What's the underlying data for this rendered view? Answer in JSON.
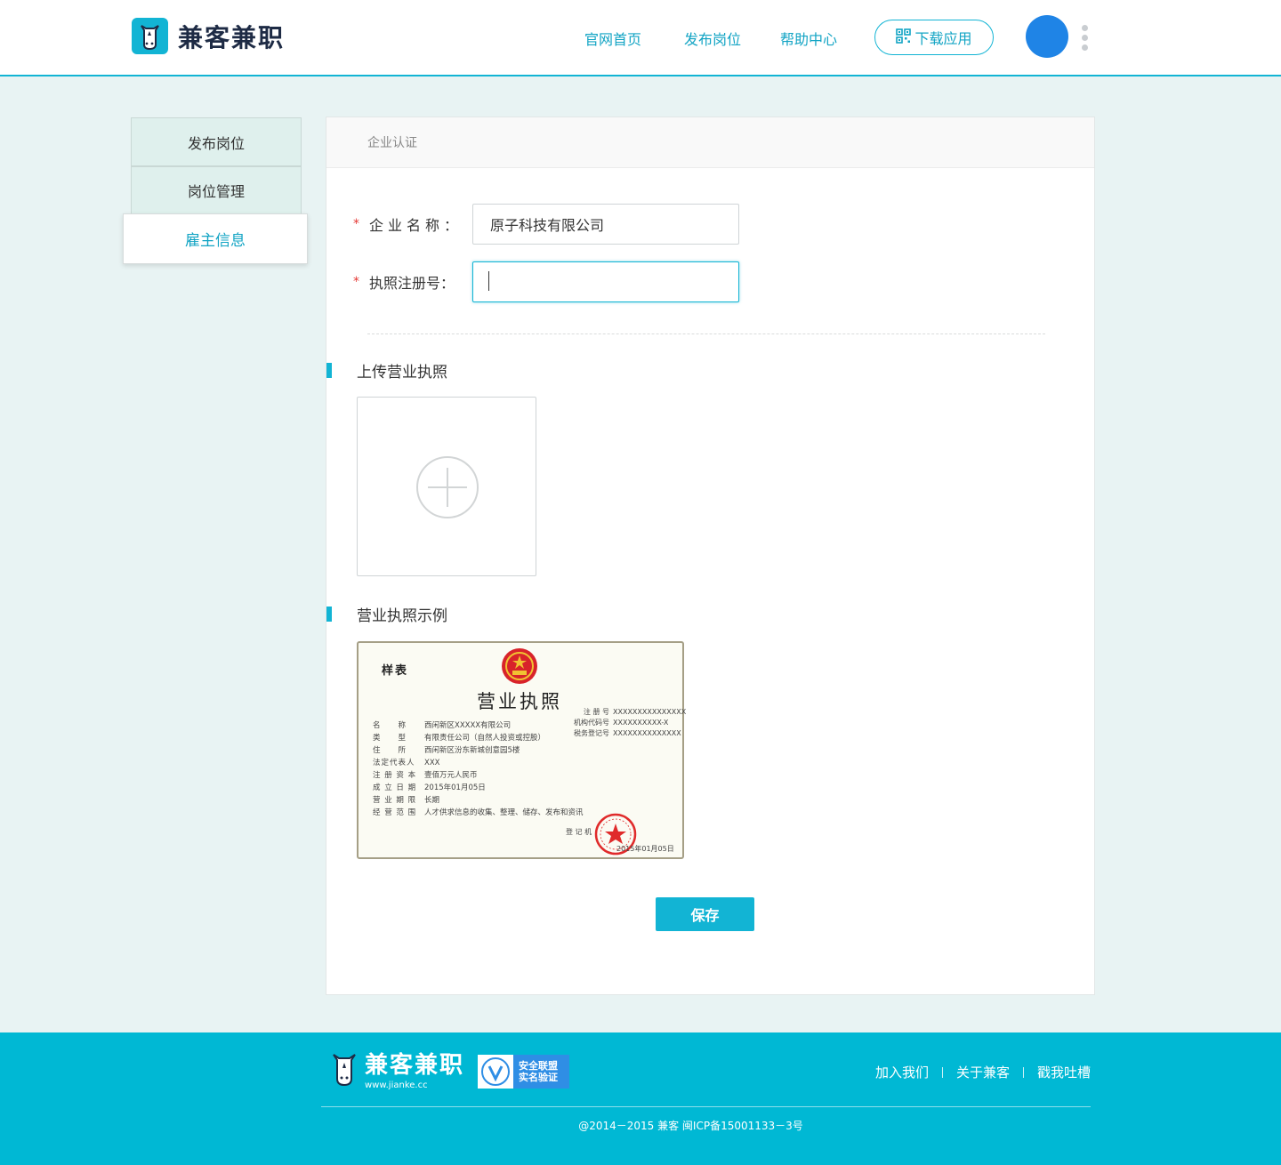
{
  "header": {
    "brand": "兼客兼职",
    "nav": [
      "官网首页",
      "发布岗位",
      "帮助中心"
    ],
    "download_label": "下载应用"
  },
  "sidebar": {
    "items": [
      {
        "label": "发布岗位",
        "active": false
      },
      {
        "label": "岗位管理",
        "active": false
      },
      {
        "label": "雇主信息",
        "active": true
      }
    ]
  },
  "panel": {
    "title": "企业认证",
    "fields": [
      {
        "label": "企业名称：",
        "required": true,
        "value": "原子科技有限公司",
        "placeholder": ""
      },
      {
        "label": "执照注册号：",
        "required": true,
        "value": "",
        "placeholder": ""
      }
    ],
    "upload_title": "上传营业执照",
    "sample_title": "营业执照示例",
    "save_label": "保存"
  },
  "license_sample": {
    "sample_mark": "样表",
    "title": "营业执照",
    "right": [
      {
        "k": "注 册 号",
        "v": "XXXXXXXXXXXXXXX"
      },
      {
        "k": "机构代码号",
        "v": "XXXXXXXXXX-X"
      },
      {
        "k": "税务登记号",
        "v": "XXXXXXXXXXXXXX"
      }
    ],
    "left": [
      {
        "k": "名　　称",
        "v": "西闲新区XXXXX有限公司"
      },
      {
        "k": "类　　型",
        "v": "有限责任公司（自然人投资或控股）"
      },
      {
        "k": "住　　所",
        "v": "西闲新区汾东新城创意园5楼"
      },
      {
        "k": "法定代表人",
        "v": "XXX"
      },
      {
        "k": "注 册 资 本",
        "v": "壹佰万元人民币"
      },
      {
        "k": "成 立 日 期",
        "v": "2015年01月05日"
      },
      {
        "k": "营 业 期 限",
        "v": "长期"
      },
      {
        "k": "经 营 范 围",
        "v": "人才供求信息的收集、整理、储存、发布和资讯"
      }
    ],
    "registrar": "登 记 机",
    "date": "2015年01月05日"
  },
  "footer": {
    "brand": "兼客兼职",
    "url": "www.jianke.cc",
    "badge_line1": "安全联盟",
    "badge_line2": "实名验证",
    "links": [
      "加入我们",
      "关于兼客",
      "戳我吐槽"
    ],
    "copyright": "@2014－2015 兼客 闽ICP备15001133－3号"
  }
}
